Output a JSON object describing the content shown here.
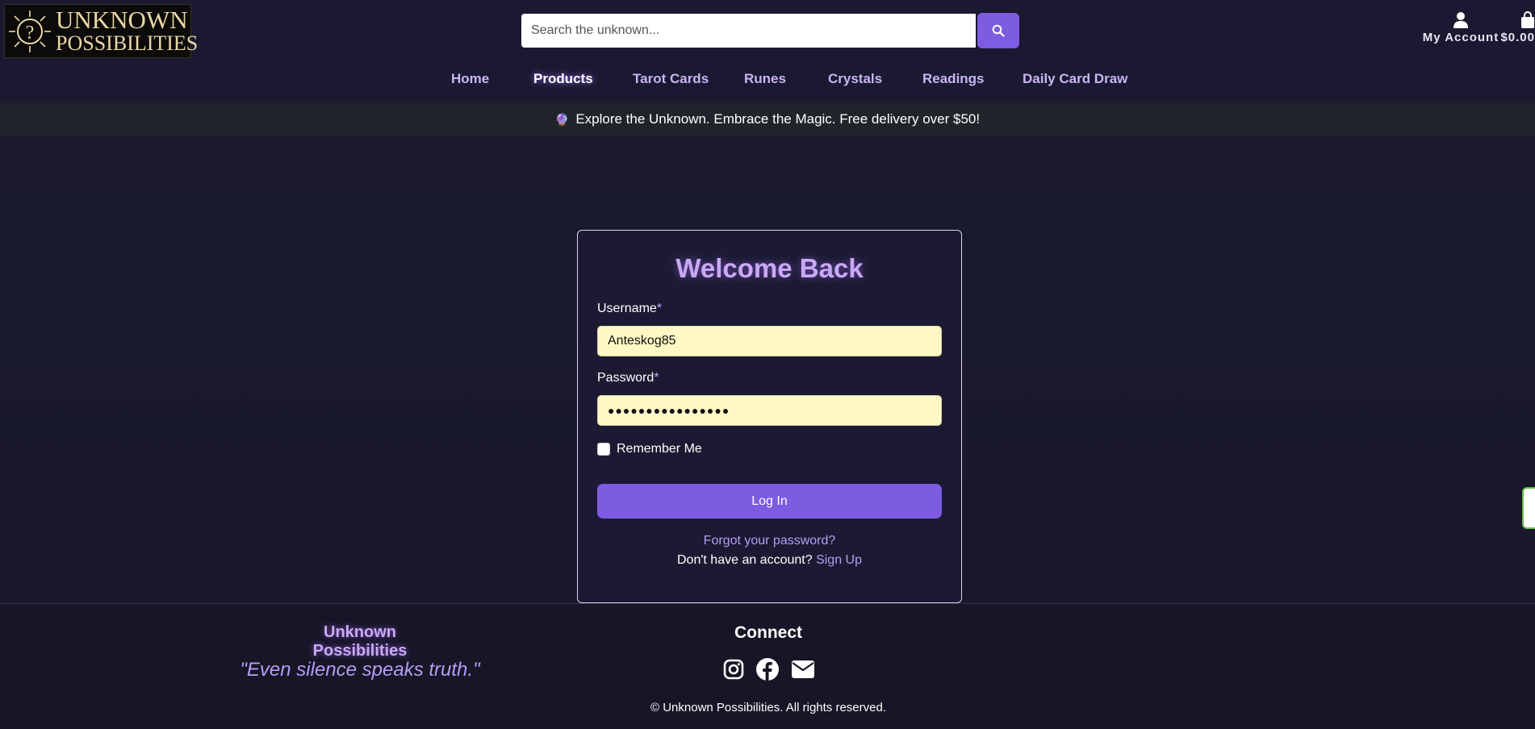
{
  "header": {
    "logo_line1": "UNKNOWN",
    "logo_line2": "POSSIBILITIES",
    "search": {
      "placeholder": "Search the unknown..."
    },
    "account_label": "My Account",
    "cart_total": "$0.00"
  },
  "nav": {
    "items": [
      {
        "label": "Home",
        "active": false
      },
      {
        "label": "Products",
        "active": true
      },
      {
        "label": "Tarot Cards",
        "active": false
      },
      {
        "label": "Runes",
        "active": false
      },
      {
        "label": "Crystals",
        "active": false
      },
      {
        "label": "Readings",
        "active": false
      },
      {
        "label": "Daily Card Draw",
        "active": false
      }
    ]
  },
  "banner": {
    "emoji": "🔮",
    "text": "Explore the Unknown. Embrace the Magic. Free delivery over $50!"
  },
  "login": {
    "title": "Welcome Back",
    "username_label": "Username",
    "username_value": "Anteskog85",
    "password_label": "Password",
    "password_value": "●●●●●●●●●●●●●●●●",
    "required_marker": "*",
    "remember_label": "Remember Me",
    "remember_checked": false,
    "submit_label": "Log In",
    "forgot_label": "Forgot your password?",
    "signup_prompt": "Don't have an account?",
    "signup_label": "Sign Up"
  },
  "footer": {
    "brand": "Unknown Possibilities",
    "quote": "\"Even silence speaks truth.\"",
    "connect_heading": "Connect",
    "social_icons": [
      "instagram-icon",
      "facebook-icon",
      "envelope-icon"
    ],
    "copyright": "© Unknown Possibilities. All rights reserved."
  },
  "colors": {
    "accent": "#7c5ce0",
    "heading_purple": "#c9a9f7",
    "background": "#1a1a2e",
    "input_fill": "#fdf8c4"
  }
}
